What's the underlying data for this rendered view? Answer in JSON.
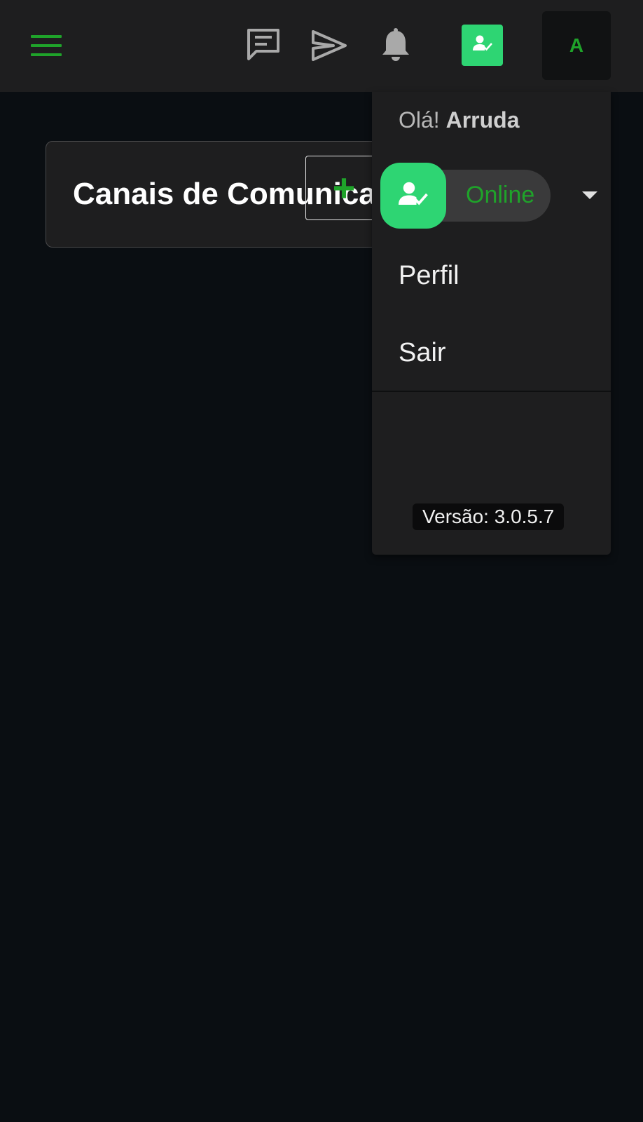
{
  "header": {
    "menu_icon": "hamburger-menu-icon",
    "icons": [
      "chat-icon",
      "send-icon",
      "bell-icon"
    ],
    "status_icon": "user-check-icon",
    "avatar_letter": "A"
  },
  "main": {
    "card_title": "Canais de Comunicação",
    "add_label": "+"
  },
  "user_menu": {
    "greeting_prefix": "Olá! ",
    "user_name": "Arruda",
    "status": "Online",
    "items": [
      {
        "label": "Perfil"
      },
      {
        "label": "Sair"
      }
    ],
    "version": "Versão: 3.0.5.7"
  },
  "colors": {
    "accent_green": "#1fa32a",
    "status_green": "#2ed573",
    "background": "#0a0e12",
    "surface": "#1e1e1f"
  }
}
